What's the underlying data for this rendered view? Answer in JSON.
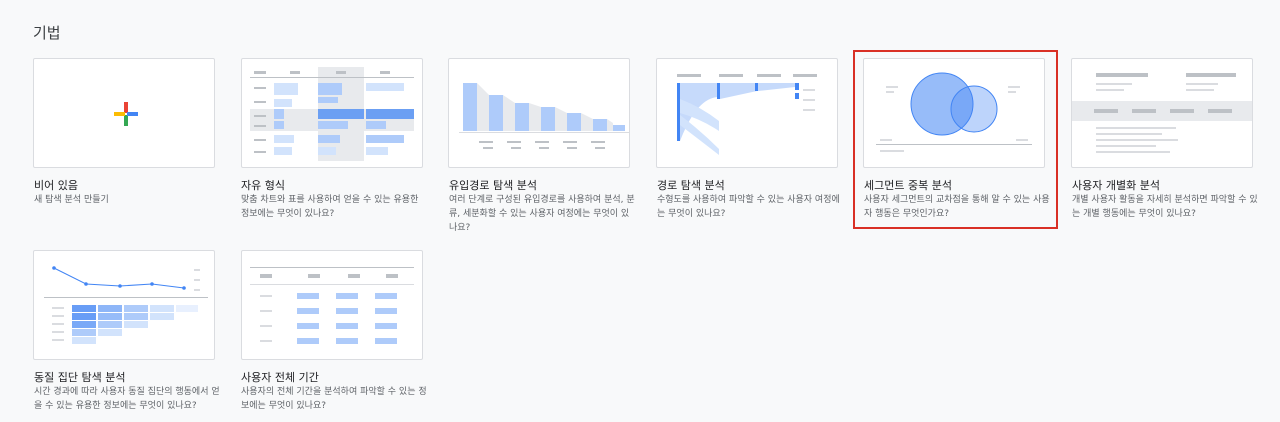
{
  "section": {
    "title": "기법"
  },
  "templates": [
    {
      "title": "비어 있음",
      "desc": "새 탐색 분석 만들기"
    },
    {
      "title": "자유 형식",
      "desc": "맞춤 차트와 표를 사용하여 얻을 수 있는 유용한 정보에는 무엇이 있나요?"
    },
    {
      "title": "유입경로 탐색 분석",
      "desc": "여러 단계로 구성된 유입경로를 사용하여 분석, 분류, 세분화할 수 있는 사용자 여정에는 무엇이 있나요?"
    },
    {
      "title": "경로 탐색 분석",
      "desc": "수형도를 사용하여 파악할 수 있는 사용자 여정에는 무엇이 있나요?"
    },
    {
      "title": "세그먼트 중복 분석",
      "desc": "사용자 세그먼트의 교차점을 통해 알 수 있는 사용자 행동은 무엇인가요?"
    },
    {
      "title": "사용자 개별화 분석",
      "desc": "개별 사용자 활동을 자세히 분석하면 파악할 수 있는 개별 행동에는 무엇이 있나요?"
    },
    {
      "title": "동질 집단 탐색 분석",
      "desc": "시간 경과에 따라 사용자 동질 집단의 행동에서 얻을 수 있는 유용한 정보에는 무엇이 있나요?"
    },
    {
      "title": "사용자 전체 기간",
      "desc": "사용자의 전체 기간을 분석하여 파악할 수 있는 정보에는 무엇이 있나요?"
    }
  ],
  "colors": {
    "accent": "#4285f4",
    "light_blue": "#aecbfa",
    "pale_blue": "#d2e3fc",
    "grey_line": "#dadce0",
    "selection_border": "#d93025",
    "plus_red": "#ea4335",
    "plus_blue": "#4285f4",
    "plus_yellow": "#fbbc04",
    "plus_green": "#34a853"
  },
  "selected_template": "세그먼트 중복 분석"
}
